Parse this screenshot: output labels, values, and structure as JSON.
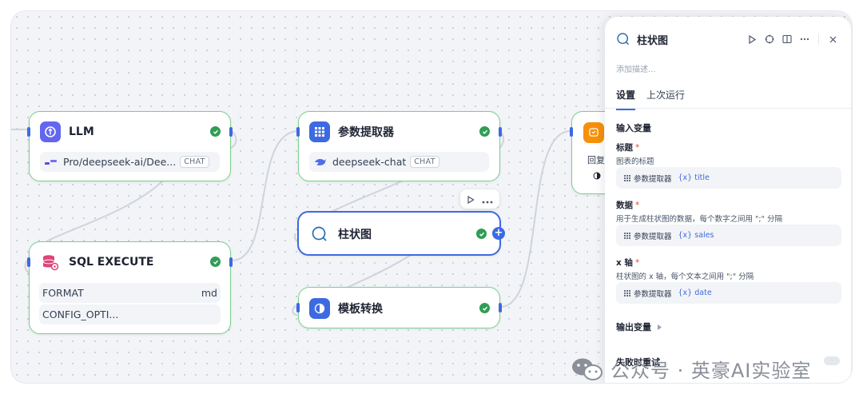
{
  "nodes": {
    "llm": {
      "title": "LLM",
      "model": "Pro/deepseek-ai/Dee...",
      "chip": "CHAT"
    },
    "param_extractor": {
      "title": "参数提取器",
      "model": "deepseek-chat",
      "chip": "CHAT"
    },
    "bar_chart": {
      "title": "柱状图"
    },
    "sql_execute": {
      "title": "SQL EXECUTE",
      "rows": [
        {
          "key": "FORMAT",
          "value": "md"
        },
        {
          "key": "CONFIG_OPTI...",
          "value": ""
        }
      ]
    },
    "template_transform": {
      "title": "模板转换"
    },
    "answer_partial": {
      "label": "回复"
    }
  },
  "panel": {
    "title": "柱状图",
    "description_placeholder": "添加描述...",
    "tabs": [
      "设置",
      "上次运行"
    ],
    "input_section": "输入变量",
    "inputs": [
      {
        "label": "标题",
        "required": "*",
        "hint": "图表的标题",
        "source": "参数提取器",
        "var_prefix": "{x}",
        "var": "title"
      },
      {
        "label": "数据",
        "required": "*",
        "hint": "用于生成柱状图的数据，每个数字之间用 \";\" 分隔",
        "source": "参数提取器",
        "var_prefix": "{x}",
        "var": "sales"
      },
      {
        "label": "x 轴",
        "required": "*",
        "hint": "柱状图的 x 轴，每个文本之间用 \";\" 分隔",
        "source": "参数提取器",
        "var_prefix": "{x}",
        "var": "date"
      }
    ],
    "output_section": "输出变量",
    "retry_section": "失败时重试"
  },
  "watermark": {
    "text": "公众号 · 英豪AI实验室"
  },
  "colors": {
    "accent": "#3e6ae1",
    "success": "#2f9e55",
    "node_border": "#7ccf8e",
    "llm_icon": "#6366f1",
    "sql_icon": "#e0447a",
    "answer_icon": "#f79009"
  }
}
